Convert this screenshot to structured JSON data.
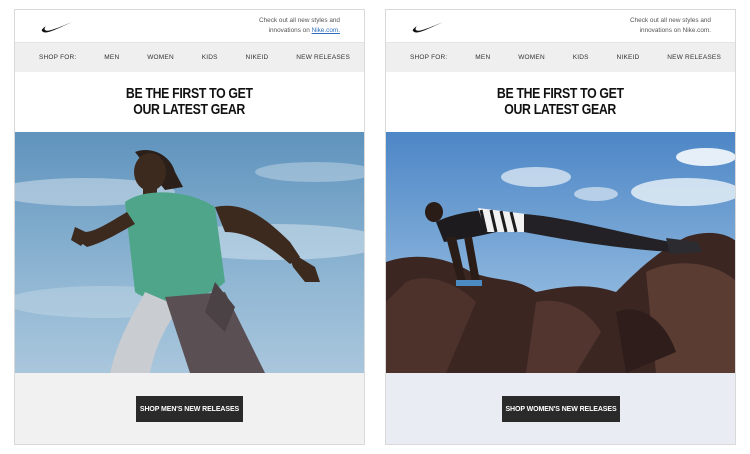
{
  "emails": [
    {
      "promo_text": "Check out all new styles and innovations on",
      "promo_link": "Nike.com.",
      "nav": [
        "SHOP FOR:",
        "MEN",
        "WOMEN",
        "KIDS",
        "NIKEID",
        "NEW RELEASES"
      ],
      "headline": [
        "BE THE FIRST TO GET",
        "OUR LATEST GEAR"
      ],
      "cta": "SHOP MEN'S NEW RELEASES",
      "hero_subject": "male runner sprinting against blue sky"
    },
    {
      "promo_text": "Check out all new styles and innovations on Nike.com.",
      "nav": [
        "SHOP FOR:",
        "MEN",
        "WOMEN",
        "KIDS",
        "NIKEID",
        "NEW RELEASES"
      ],
      "headline": [
        "BE THE FIRST TO GET",
        "OUR LATEST GEAR"
      ],
      "cta": "SHOP WOMEN'S NEW RELEASES",
      "hero_subject": "female athlete in plank pose on dark rocks"
    }
  ],
  "colors": {
    "cta_bg": "#2a2a2a",
    "nav_bg": "#efefef",
    "link": "#2e6ebd"
  },
  "icons": {
    "logo": "swoosh-logo"
  }
}
